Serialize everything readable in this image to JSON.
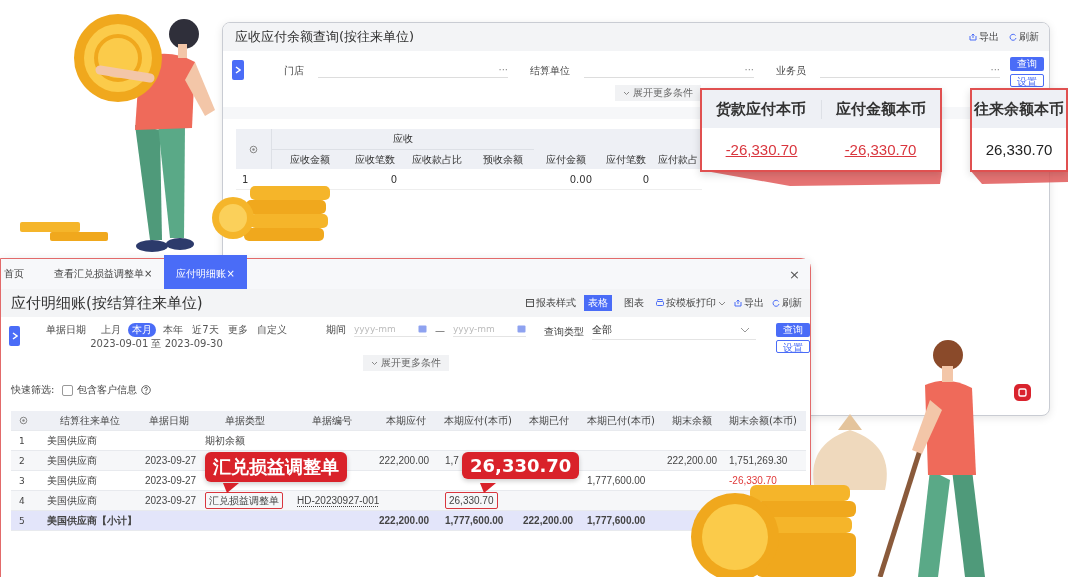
{
  "back_window": {
    "title": "应收应付余额查询(按往来单位)",
    "actions": [
      {
        "kind": "export",
        "label": "导出"
      },
      {
        "kind": "refresh",
        "label": "刷新"
      }
    ],
    "filters": [
      {
        "label": "门店",
        "more": "···"
      },
      {
        "label": "结算单位",
        "more": "···"
      },
      {
        "label": "业务员",
        "more": "···"
      }
    ],
    "buttons": [
      {
        "kind": "primary",
        "label": "查询"
      },
      {
        "kind": "secondary",
        "label": "设置"
      }
    ],
    "expand": "展开更多条件",
    "table": {
      "group": "应收",
      "columns": [
        "应收金额",
        "应收笔数",
        "应收款占比",
        "预收余额",
        "应付金额",
        "应付笔数",
        "应付款占"
      ],
      "rows": [
        {
          "number": "1",
          "cells": [
            null,
            "0",
            null,
            null,
            "0.00",
            "0",
            null
          ]
        }
      ]
    },
    "callouts": [
      {
        "columns": [
          {
            "label": "货款应付本币",
            "value": "-26,330.70",
            "negative": true
          },
          {
            "label": "应付金额本币",
            "value": "-26,330.70",
            "negative": true
          }
        ]
      },
      {
        "columns": [
          {
            "label": "往来余额本币",
            "value": "26,330.70",
            "negative": false
          }
        ]
      }
    ]
  },
  "front_window": {
    "tabs": [
      {
        "label": "首页",
        "selected": false
      },
      {
        "label": "查看汇兑损益调整单",
        "close": "×",
        "selected": false
      },
      {
        "label": "应付明细账",
        "close": "×",
        "selected": true
      }
    ],
    "close": "×",
    "title": "应付明细账(按结算往来单位)",
    "toolbar": [
      {
        "kind": "style",
        "label": "报表样式"
      },
      {
        "kind": "toggle",
        "label": "表格",
        "selected": true
      },
      {
        "kind": "toggle",
        "label": "图表",
        "selected": false
      },
      {
        "kind": "print",
        "label": "按模板打印"
      },
      {
        "kind": "export",
        "label": "导出"
      },
      {
        "kind": "refresh",
        "label": "刷新"
      }
    ],
    "date_filter": {
      "label": "单据日期",
      "presets": [
        {
          "label": "上月",
          "selected": false
        },
        {
          "label": "本月",
          "selected": true
        },
        {
          "label": "本年",
          "selected": false
        },
        {
          "label": "近7天",
          "selected": false
        },
        {
          "label": "更多",
          "selected": false
        },
        {
          "label": "自定义",
          "selected": false
        }
      ],
      "range": "2023-09-01 至 2023-09-30"
    },
    "period": {
      "label": "期间",
      "from_placeholder": "yyyy-mm",
      "dash": "—",
      "to_placeholder": "yyyy-mm"
    },
    "query_type": {
      "label": "查询类型",
      "value": "全部"
    },
    "buttons": [
      {
        "kind": "primary",
        "label": "查询"
      },
      {
        "kind": "secondary",
        "label": "设置"
      }
    ],
    "expand": "展开更多条件",
    "quick_filter": {
      "label": "快速筛选:",
      "option": "包含客户信息",
      "checked": false
    },
    "table": {
      "columns": [
        "结算往来单位",
        "单据日期",
        "单据类型",
        "单据编号",
        "本期应付",
        "本期应付(本币)",
        "本期已付",
        "本期已付(本币)",
        "期末余额",
        "期末余额(本币)"
      ],
      "rows": [
        {
          "number": "1",
          "subtotal": false,
          "cells": [
            "美国供应商",
            null,
            "期初余额",
            null,
            null,
            null,
            null,
            null,
            null,
            null
          ]
        },
        {
          "number": "2",
          "subtotal": false,
          "cells": [
            "美国供应商",
            "2023-09-27",
            null,
            null,
            "222,200.00",
            "1,7",
            null,
            null,
            "222,200.00",
            "1,751,269.30"
          ]
        },
        {
          "number": "3",
          "subtotal": false,
          "cells": [
            "美国供应商",
            "2023-09-27",
            null,
            null,
            null,
            null,
            null,
            "1,777,600.00",
            null,
            {
              "text": "-26,330.70",
              "kind": "negative"
            }
          ]
        },
        {
          "number": "4",
          "subtotal": false,
          "cells": [
            "美国供应商",
            "2023-09-27",
            {
              "text": "汇兑损益调整单",
              "kind": "boxed"
            },
            {
              "text": "HD-20230927-001",
              "kind": "link"
            },
            null,
            {
              "text": "26,330.70",
              "kind": "boxed"
            },
            null,
            null,
            null,
            null
          ]
        },
        {
          "number": "5",
          "subtotal": true,
          "cells": [
            "美国供应商【小计】",
            null,
            null,
            null,
            "222,200.00",
            "1,777,600.00",
            "222,200.00",
            "1,777,600.00",
            null,
            null
          ]
        }
      ]
    },
    "callouts": [
      {
        "text": "汇兑损益调整单"
      },
      {
        "text": "26,330.70"
      }
    ]
  }
}
